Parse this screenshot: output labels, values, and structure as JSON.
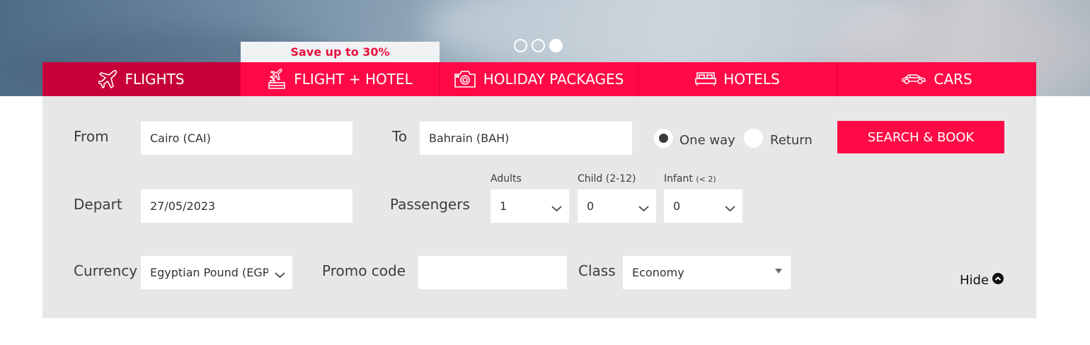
{
  "carousel": {
    "slides": 3,
    "active_index": 2
  },
  "promo": {
    "text": "Save up to 30%"
  },
  "tabs": [
    {
      "label": "FLIGHTS",
      "icon": "plane-icon",
      "active": true
    },
    {
      "label": "FLIGHT + HOTEL",
      "icon": "plane-hotel-icon",
      "active": false
    },
    {
      "label": "HOLIDAY PACKAGES",
      "icon": "camera-icon",
      "active": false
    },
    {
      "label": "HOTELS",
      "icon": "bed-icon",
      "active": false
    },
    {
      "label": "CARS",
      "icon": "car-icon",
      "active": false
    }
  ],
  "form": {
    "from_label": "From",
    "from_value": "Cairo (CAI)",
    "to_label": "To",
    "to_value": "Bahrain (BAH)",
    "trip_type": {
      "one_way_label": "One way",
      "return_label": "Return",
      "selected": "One way"
    },
    "search_button": "SEARCH & BOOK",
    "depart_label": "Depart",
    "depart_value": "27/05/2023",
    "passengers_label": "Passengers",
    "adults_label": "Adults",
    "adults_value": "1",
    "child_label": "Child (2-12)",
    "child_value": "0",
    "infant_label": "Infant",
    "infant_hint": "(< 2)",
    "infant_value": "0",
    "currency_label": "Currency",
    "currency_value": "Egyptian Pound (EGP)",
    "promo_label": "Promo code",
    "promo_value": "",
    "class_label": "Class",
    "class_value": "Economy",
    "hide_label": "Hide"
  },
  "colors": {
    "brand": "#ff0a46",
    "active_tab": "#c8003a",
    "panel": "#e7e7e7"
  }
}
